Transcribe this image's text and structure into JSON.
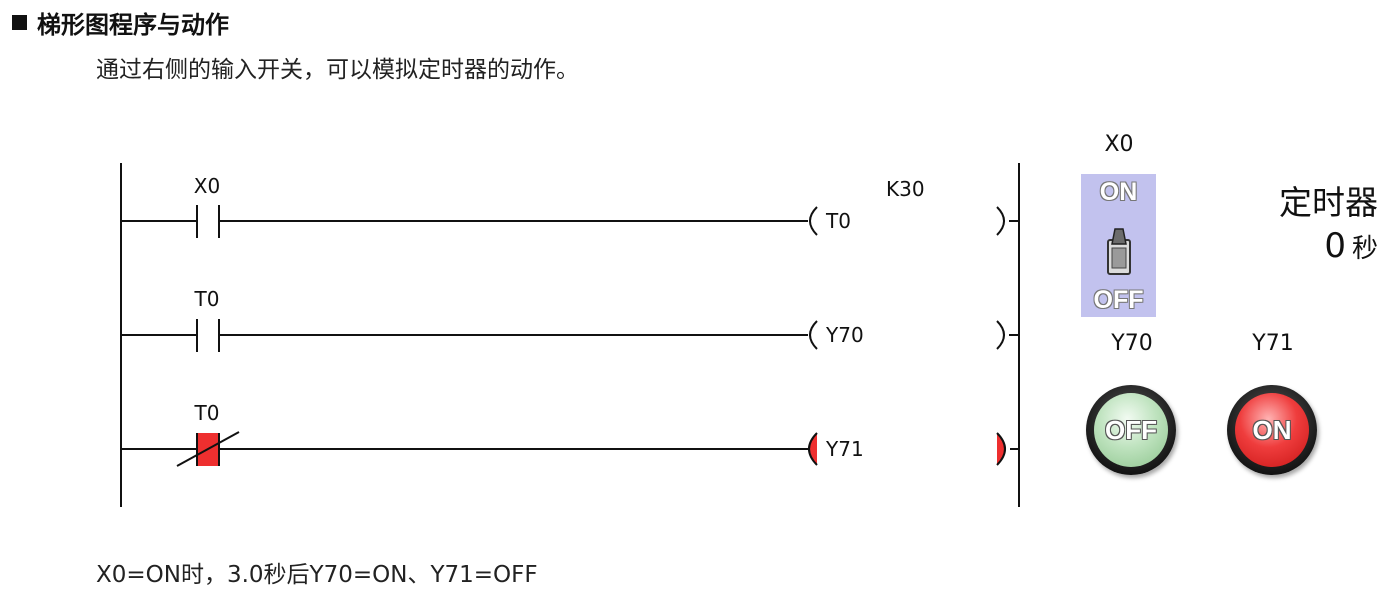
{
  "section": {
    "title": "梯形图程序与动作"
  },
  "description": "通过右侧的输入开关，可以模拟定时器的动作。",
  "ladder": {
    "rungs": [
      {
        "contact_label": "X0",
        "contact_type": "normally-open",
        "coil_label": "T0",
        "active": false
      },
      {
        "contact_label": "T0",
        "contact_type": "normally-open",
        "coil_label": "Y70",
        "active": false
      },
      {
        "contact_label": "T0",
        "contact_type": "normally-closed",
        "coil_label": "Y71",
        "active": true
      }
    ],
    "timer_constant": "K30",
    "active_color": "#ee2f2f"
  },
  "panel": {
    "switch": {
      "label": "X0",
      "on_text": "ON",
      "off_text": "OFF",
      "state": "OFF"
    },
    "timer": {
      "title": "定时器",
      "value": "0",
      "unit": "秒"
    },
    "lamps": [
      {
        "label": "Y70",
        "state_text": "OFF",
        "color": "#8cc48c"
      },
      {
        "label": "Y71",
        "state_text": "ON",
        "color": "#e02020"
      }
    ]
  },
  "footer_note": "X0=ON时，3.0秒后Y70=ON、Y71=OFF"
}
